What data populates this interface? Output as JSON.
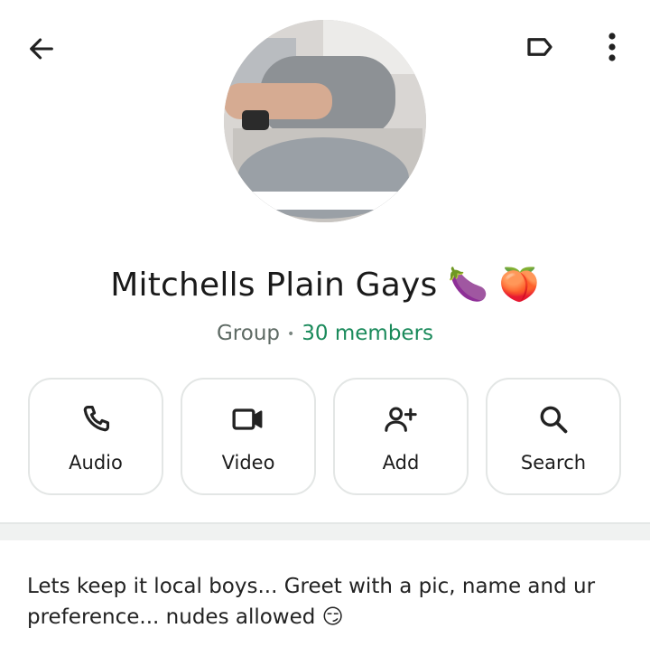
{
  "header": {
    "back_icon": "arrow-left-icon",
    "label_icon": "label-tag-icon",
    "more_icon": "more-vertical-icon"
  },
  "group": {
    "name": "Mitchells Plain Gays 🍆 🍑",
    "type": "Group",
    "separator": "•",
    "members": "30 members"
  },
  "actions": [
    {
      "label": "Audio",
      "icon": "phone-icon"
    },
    {
      "label": "Video",
      "icon": "video-camera-icon"
    },
    {
      "label": "Add",
      "icon": "add-person-icon"
    },
    {
      "label": "Search",
      "icon": "search-icon"
    }
  ],
  "description": "Lets keep it local boys... Greet with a pic, name and ur preference... nudes allowed 😏",
  "colors": {
    "accent": "#1a8a5b",
    "muted": "#5e6a64",
    "card_border": "#e3e6e5"
  }
}
